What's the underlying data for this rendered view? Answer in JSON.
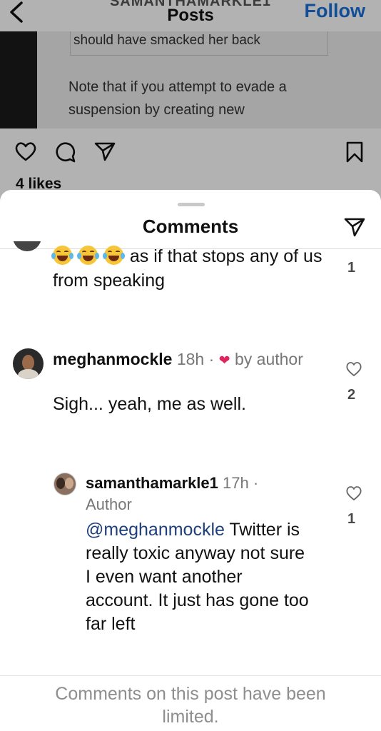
{
  "header": {
    "username_partial": "SAMANTHAMARKLE1",
    "title": "Posts",
    "follow_label": "Follow"
  },
  "post_image": {
    "quote_line": "should have smacked her back",
    "note_line1": "Note that if you attempt to evade a",
    "note_line2": "suspension by creating new"
  },
  "post": {
    "likes": "4 likes"
  },
  "comments_sheet": {
    "title": "Comments",
    "comments": [
      {
        "text": "as if that stops any of us from speaking",
        "emoji": [
          "face-with-tears-of-joy",
          "face-with-tears-of-joy",
          "face-with-tears-of-joy"
        ],
        "like_count": "1"
      },
      {
        "username": "meghanmockle",
        "time": "18h",
        "liked_by": "by author",
        "text": "Sigh... yeah, me as well.",
        "like_count": "2"
      },
      {
        "username": "samanthamarkle1",
        "time": "17h",
        "badge": "Author",
        "mention": "@meghanmockle",
        "text": " Twitter is really toxic anyway not sure I even want another account. It just has gone too far left",
        "like_count": "1"
      }
    ],
    "footer": "Comments on this post have been limited."
  },
  "colors": {
    "follow": "#1a6fd8",
    "liked_heart": "#e0245e",
    "mention": "#1e3f7a",
    "muted_text": "#8e8e8e"
  },
  "icons": [
    "back-chevron-icon",
    "heart-icon",
    "comment-icon",
    "share-icon",
    "bookmark-icon",
    "send-icon"
  ]
}
